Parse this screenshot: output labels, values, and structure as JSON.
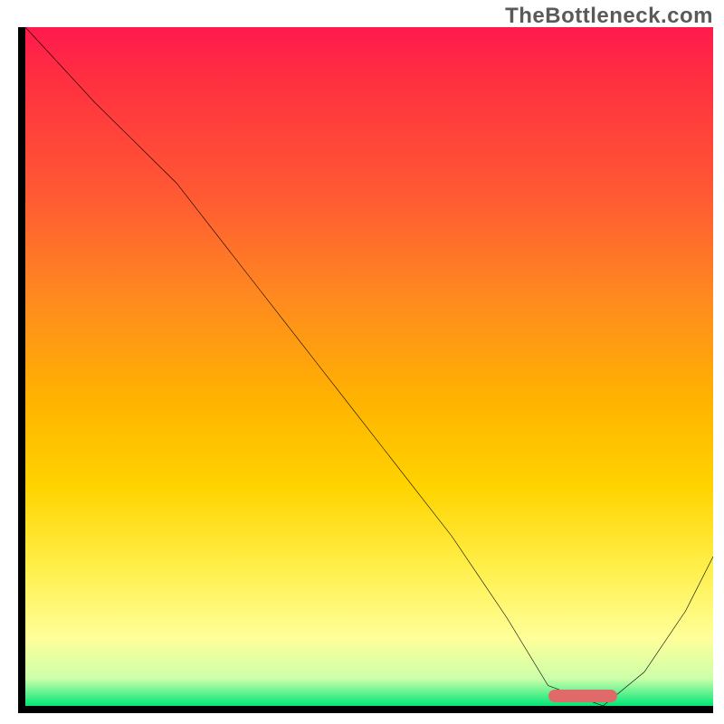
{
  "watermark": "TheBottleneck.com",
  "chart_data": {
    "type": "line",
    "title": "",
    "xlabel": "",
    "ylabel": "",
    "xlim": [
      0,
      100
    ],
    "ylim": [
      0,
      100
    ],
    "grid": false,
    "legend": false,
    "series": [
      {
        "name": "bottleneck-curve",
        "color": "#000000",
        "x": [
          0,
          10,
          22,
          32,
          42,
          52,
          62,
          70,
          76,
          84,
          90,
          96,
          100
        ],
        "values": [
          100,
          89,
          77,
          64,
          51,
          38,
          25,
          13,
          3,
          0,
          5,
          14,
          22
        ]
      }
    ],
    "gradient_stops": [
      {
        "pos": 0,
        "color": "#ff1a4d"
      },
      {
        "pos": 8,
        "color": "#ff3040"
      },
      {
        "pos": 25,
        "color": "#ff5a33"
      },
      {
        "pos": 40,
        "color": "#ff8a1f"
      },
      {
        "pos": 55,
        "color": "#ffb300"
      },
      {
        "pos": 68,
        "color": "#ffd400"
      },
      {
        "pos": 80,
        "color": "#fff04d"
      },
      {
        "pos": 90,
        "color": "#ffff99"
      },
      {
        "pos": 96,
        "color": "#ccffaa"
      },
      {
        "pos": 100,
        "color": "#00e676"
      }
    ],
    "marker": {
      "name": "optimal-range",
      "color": "#e06a6a",
      "x_start": 76,
      "x_end": 86,
      "y": 0
    }
  }
}
